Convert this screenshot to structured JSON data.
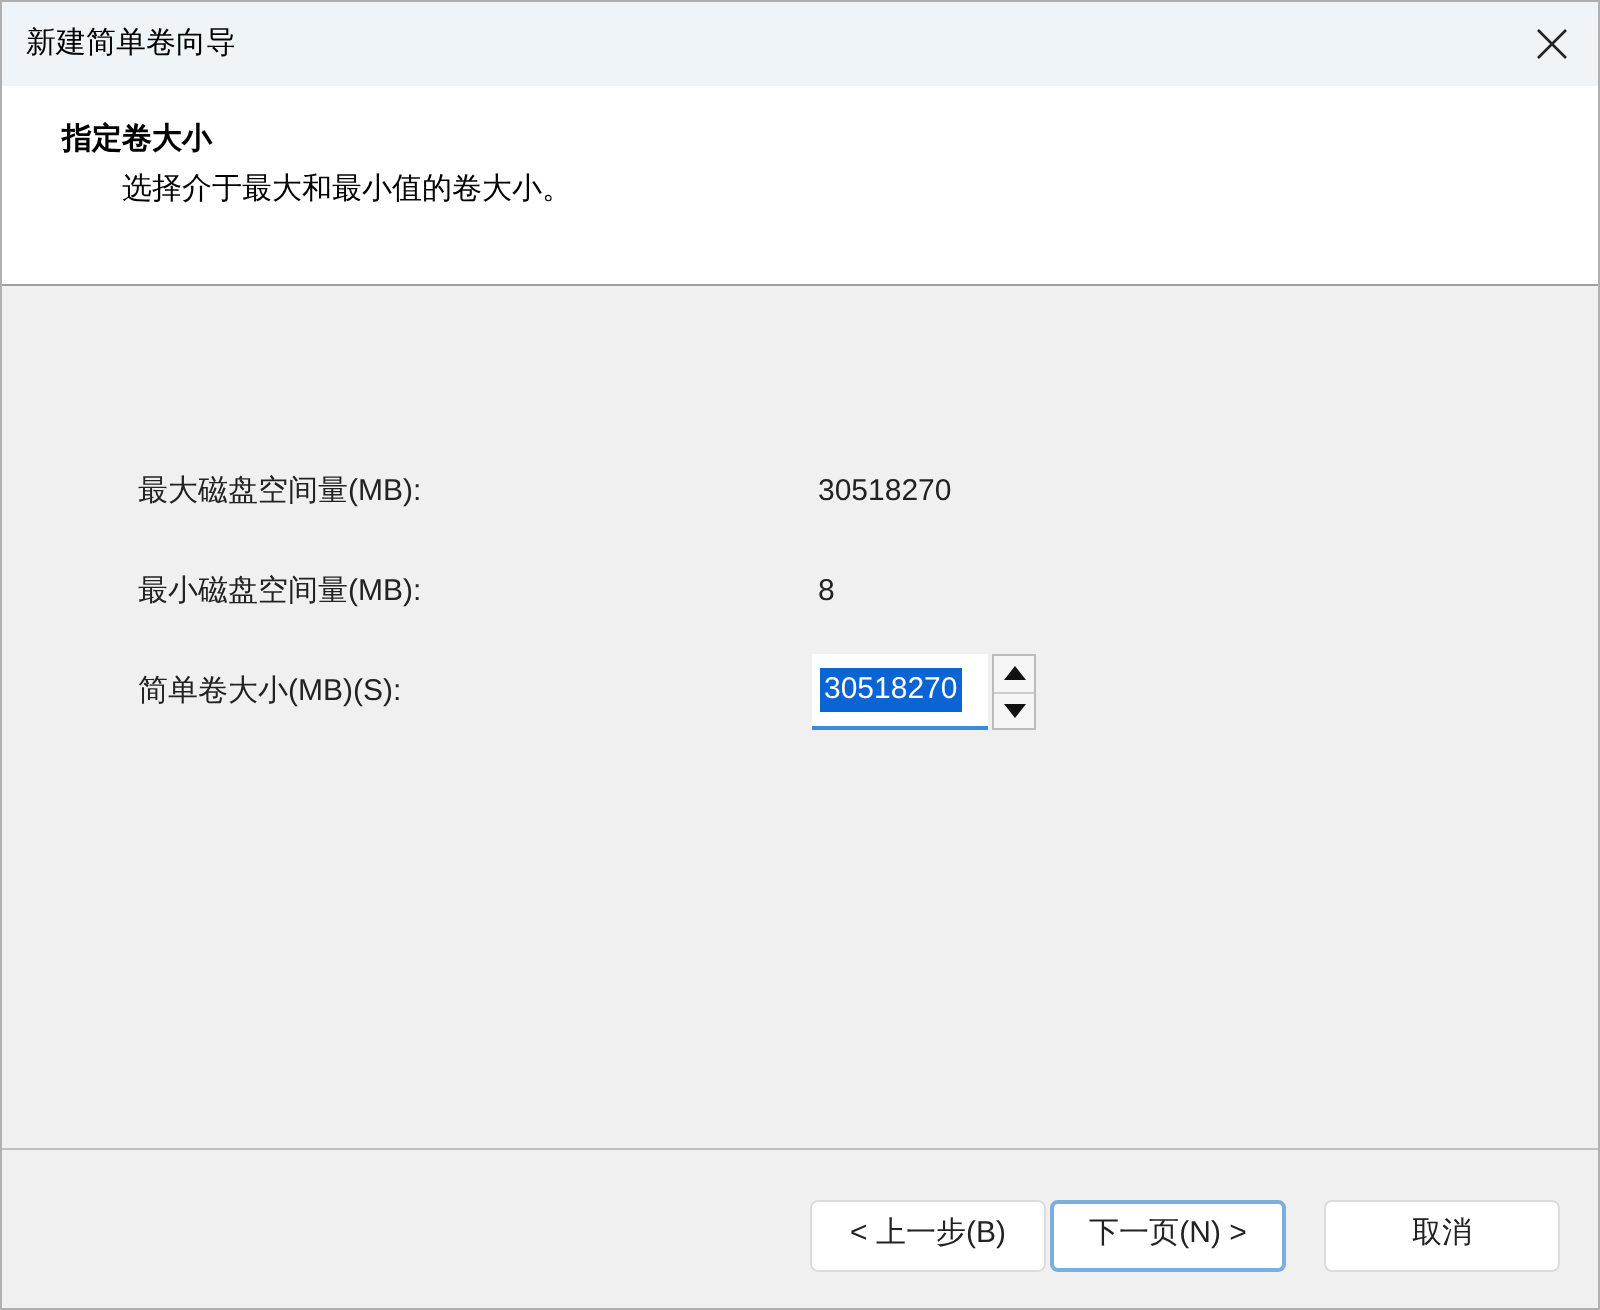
{
  "window": {
    "title": "新建简单卷向导"
  },
  "header": {
    "title": "指定卷大小",
    "subtitle": "选择介于最大和最小值的卷大小。"
  },
  "fields": [
    {
      "kind": "readout",
      "label": "最大磁盘空间量(MB):",
      "value": "30518270"
    },
    {
      "kind": "readout",
      "label": "最小磁盘空间量(MB):",
      "value": "8"
    },
    {
      "kind": "spin",
      "label": "简单卷大小(MB)(S):",
      "value": "30518270",
      "text_selected": true
    }
  ],
  "buttons": [
    {
      "label": "< 上一步(B)",
      "default": false
    },
    {
      "label": "下一页(N) >",
      "default": true
    },
    {
      "label": "取消",
      "default": false
    }
  ]
}
